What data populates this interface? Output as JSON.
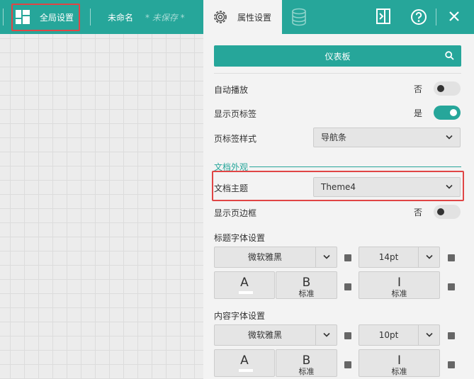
{
  "toolbar": {
    "global_settings_label": "全局设置",
    "doc_name": "未命名",
    "doc_status": "* 未保存 *",
    "tab_properties_label": "属性设置",
    "icons": [
      "dashboard-layout-icon",
      "gear-icon",
      "database-icon",
      "panel-toggle-icon",
      "help-icon",
      "close-icon"
    ]
  },
  "panel": {
    "search_title": "仪表板",
    "auto_play": {
      "label": "自动播放",
      "value_text": "否",
      "on": false
    },
    "show_tab_labels": {
      "label": "显示页标签",
      "value_text": "是",
      "on": true
    },
    "tab_label_style": {
      "label": "页标签样式",
      "value": "导航条"
    },
    "doc_appearance_title": "文档外观",
    "doc_theme": {
      "label": "文档主题",
      "value": "Theme4"
    },
    "show_page_border": {
      "label": "显示页边框",
      "value_text": "否",
      "on": false
    },
    "title_font": {
      "label": "标题字体设置",
      "family": "微软雅黑",
      "size": "14pt",
      "color_glyph": "A",
      "bold_glyph": "B",
      "bold_sub": "标准",
      "italic_glyph": "I",
      "italic_sub": "标准"
    },
    "content_font": {
      "label": "内容字体设置",
      "family": "微软雅黑",
      "size": "10pt",
      "color_glyph": "A",
      "bold_glyph": "B",
      "bold_sub": "标准",
      "italic_glyph": "I",
      "italic_sub": "标准"
    }
  },
  "colors": {
    "accent": "#26a69a",
    "highlight": "#e04545",
    "panel_bg": "#f3f3f3"
  }
}
